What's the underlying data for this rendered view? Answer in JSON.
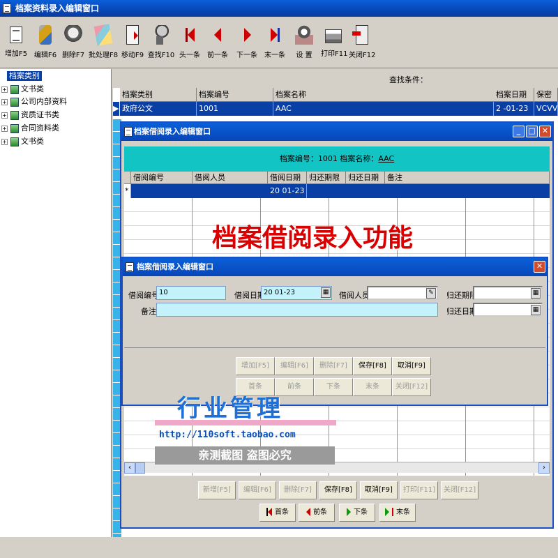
{
  "main_window": {
    "title": "档案资料录入编辑窗口"
  },
  "toolbar": [
    {
      "label": "增加F5",
      "icon": "add-doc-icon"
    },
    {
      "label": "编辑F6",
      "icon": "edit-icon"
    },
    {
      "label": "删除F7",
      "icon": "delete-icon"
    },
    {
      "label": "批处理F8",
      "icon": "batch-icon"
    },
    {
      "label": "移动F9",
      "icon": "move-icon"
    },
    {
      "label": "查找F10",
      "icon": "find-icon"
    },
    {
      "label": "头一条",
      "icon": "first-record-icon"
    },
    {
      "label": "前一条",
      "icon": "previous-record-icon"
    },
    {
      "label": "下一条",
      "icon": "next-record-icon"
    },
    {
      "label": "末一条",
      "icon": "last-record-icon"
    },
    {
      "label": "设 置",
      "icon": "settings-icon"
    },
    {
      "label": "打印F11",
      "icon": "printer-icon"
    },
    {
      "label": "关闭F12",
      "icon": "exit-icon"
    }
  ],
  "tree": {
    "root": "档案类别",
    "items": [
      "文书类",
      "公司内部资料",
      "资质证书类",
      "合同资料类",
      "文书类"
    ]
  },
  "search": {
    "label": "查找条件："
  },
  "main_grid": {
    "columns": [
      "档案类别",
      "档案编号",
      "档案名称",
      "档案日期",
      "保密等级"
    ],
    "rows": [
      {
        "category": "政府公文",
        "number": "1001",
        "name": "AAC",
        "date": "2    -01-23",
        "secret": "VCVV"
      }
    ]
  },
  "borrow_window": {
    "title": "档案借阅录入编辑窗口",
    "info_prefix": "档案编号：1001  档案名称：",
    "info_name": "AAC",
    "columns": [
      "借阅编号",
      "借阅人员",
      "借阅日期",
      "归还期限",
      "归还日期",
      "备注"
    ],
    "row_marker": "*",
    "row_date": "20     01-23",
    "buttons": [
      {
        "label": "新增[F5]",
        "enabled": false
      },
      {
        "label": "编辑[F6]",
        "enabled": false
      },
      {
        "label": "删除[F7]",
        "enabled": false
      },
      {
        "label": "保存[F8]",
        "enabled": true
      },
      {
        "label": "取消[F9]",
        "enabled": true
      },
      {
        "label": "打印[F11]",
        "enabled": false
      },
      {
        "label": "关闭[F12]",
        "enabled": false
      }
    ],
    "nav": [
      "首条",
      "前条",
      "下条",
      "末条"
    ]
  },
  "entry_dialog": {
    "title": "档案借阅录入编辑窗口",
    "fields": {
      "borrow_no_label": "借阅编号",
      "borrow_no_value": "10",
      "borrow_date_label": "借阅日期",
      "borrow_date_value": "20      01-23",
      "borrower_label": "借阅人员",
      "borrower_value": "",
      "due_label": "归还期限",
      "due_value": "",
      "remark_label": "备注",
      "remark_value": "",
      "return_label": "归还日期",
      "return_value": ""
    },
    "buttons_row1": [
      {
        "label": "增加[F5]",
        "enabled": false
      },
      {
        "label": "编辑[F6]",
        "enabled": false
      },
      {
        "label": "删除[F7]",
        "enabled": false
      },
      {
        "label": "保存[F8]",
        "enabled": true
      },
      {
        "label": "取消[F9]",
        "enabled": true
      }
    ],
    "buttons_row2": [
      {
        "label": "首条",
        "enabled": false
      },
      {
        "label": "前条",
        "enabled": false
      },
      {
        "label": "下条",
        "enabled": false
      },
      {
        "label": "末条",
        "enabled": false
      },
      {
        "label": "关闭[F12]",
        "enabled": false
      }
    ]
  },
  "overlays": {
    "feature_text": "档案借阅录入功能",
    "industry_text": "行业管理",
    "url": "http://110soft.taobao.com",
    "notice": "亲测截图 盗图必究"
  },
  "colors": {
    "title_blue": "#0846b8",
    "info_teal": "#13c4c4",
    "selection": "#0a3fa5",
    "field_cyan": "#c4f2fb"
  }
}
